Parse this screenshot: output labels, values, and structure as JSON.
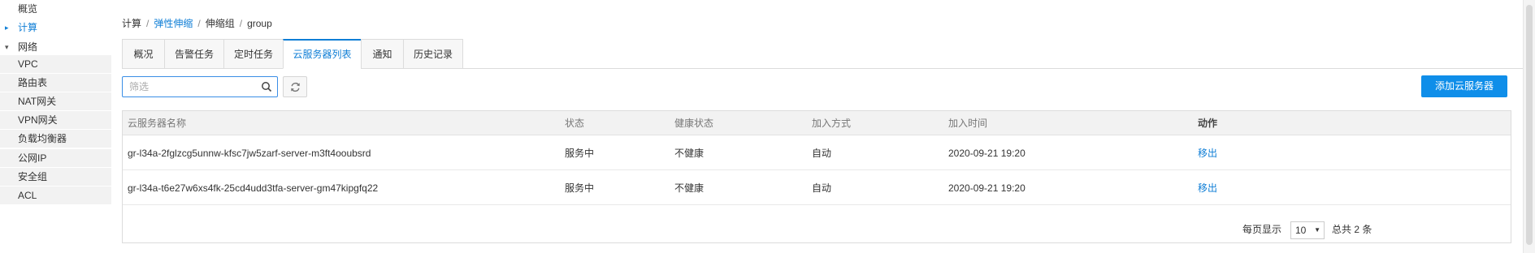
{
  "sidebar": {
    "items": [
      {
        "label": "概览"
      },
      {
        "label": "计算"
      },
      {
        "label": "网络"
      },
      {
        "label": "VPC"
      },
      {
        "label": "路由表"
      },
      {
        "label": "NAT网关"
      },
      {
        "label": "VPN网关"
      },
      {
        "label": "负载均衡器"
      },
      {
        "label": "公网IP"
      },
      {
        "label": "安全组"
      },
      {
        "label": "ACL"
      }
    ]
  },
  "breadcrumb": {
    "items": [
      "计算",
      "弹性伸缩",
      "伸缩组",
      "group"
    ],
    "separator": "/"
  },
  "tabs": [
    {
      "label": "概况"
    },
    {
      "label": "告警任务"
    },
    {
      "label": "定时任务"
    },
    {
      "label": "云服务器列表",
      "active": true
    },
    {
      "label": "通知"
    },
    {
      "label": "历史记录"
    }
  ],
  "toolbar": {
    "search_placeholder": "筛选",
    "add_button_label": "添加云服务器"
  },
  "table": {
    "columns": [
      "云服务器名称",
      "状态",
      "健康状态",
      "加入方式",
      "加入时间",
      "动作"
    ],
    "rows": [
      [
        "gr-l34a-2fglzcg5unnw-kfsc7jw5zarf-server-m3ft4ooubsrd",
        "服务中",
        "不健康",
        "自动",
        "2020-09-21 19:20",
        "移出"
      ],
      [
        "gr-l34a-t6e27w6xs4fk-25cd4udd3tfa-server-gm47kipgfq22",
        "服务中",
        "不健康",
        "自动",
        "2020-09-21 19:20",
        "移出"
      ]
    ]
  },
  "pagination": {
    "per_page_label": "每页显示",
    "per_page_value": "10",
    "total_label": "总共 2 条"
  },
  "colors": {
    "accent": "#0f7ed6",
    "primary_button": "#0f8ee9"
  }
}
